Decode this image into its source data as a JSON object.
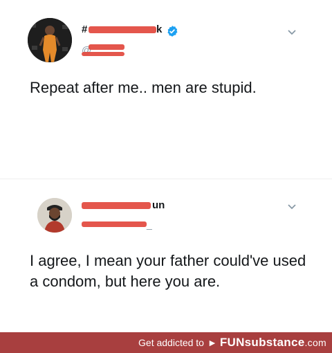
{
  "tweets": [
    {
      "name_prefix": "#",
      "name_suffix": "k",
      "verified": true,
      "handle_prefix": "@",
      "text": "Repeat after me.. men are stupid.",
      "avatar_icon": "person-photo-avatar",
      "menu_icon": "chevron-down-icon"
    },
    {
      "name_suffix": "un",
      "handle_suffix": "_",
      "text": "I agree, I mean your father could've used a condom, but here you are.",
      "avatar_icon": "person-photo-avatar",
      "menu_icon": "chevron-down-icon"
    }
  ],
  "footer": {
    "lead": "Get addicted to",
    "brand": "FUNsubstance",
    "suffix": ".com",
    "background": "#a83f3f"
  },
  "colors": {
    "redaction": "#e2483d",
    "verified_badge": "#1da1f2",
    "text": "#14171a",
    "muted": "#8899a6"
  }
}
